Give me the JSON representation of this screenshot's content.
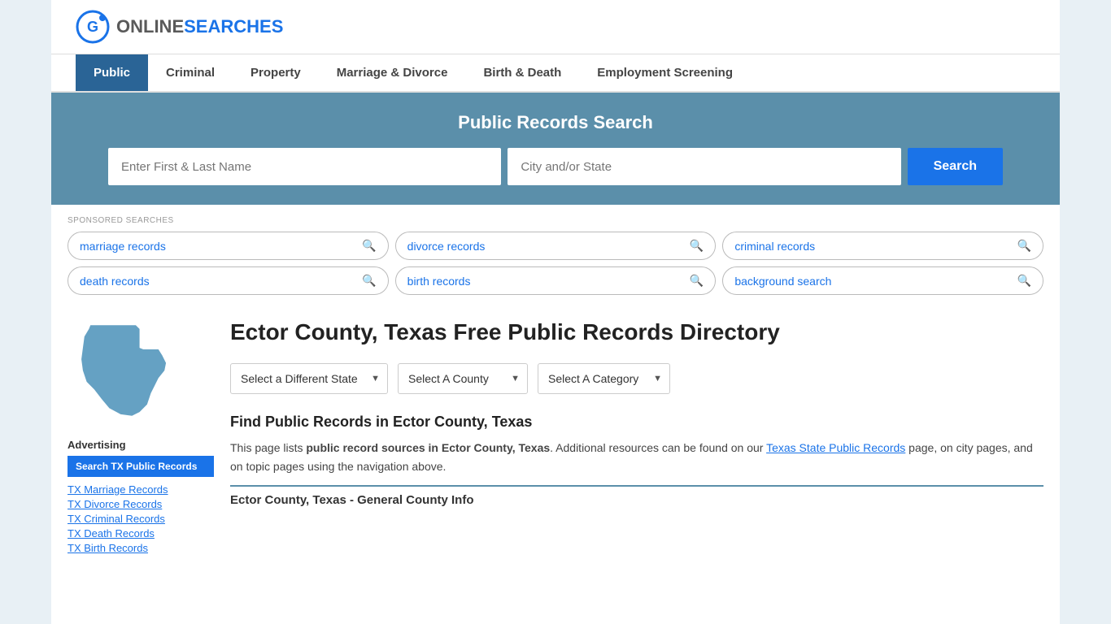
{
  "header": {
    "logo_online": "ONLINE",
    "logo_searches": "SEARCHES"
  },
  "nav": {
    "items": [
      {
        "label": "Public",
        "active": true
      },
      {
        "label": "Criminal",
        "active": false
      },
      {
        "label": "Property",
        "active": false
      },
      {
        "label": "Marriage & Divorce",
        "active": false
      },
      {
        "label": "Birth & Death",
        "active": false
      },
      {
        "label": "Employment Screening",
        "active": false
      }
    ]
  },
  "search_banner": {
    "title": "Public Records Search",
    "name_placeholder": "Enter First & Last Name",
    "location_placeholder": "City and/or State",
    "search_button": "Search"
  },
  "sponsored": {
    "label": "SPONSORED SEARCHES",
    "pills": [
      {
        "text": "marriage records"
      },
      {
        "text": "divorce records"
      },
      {
        "text": "criminal records"
      },
      {
        "text": "death records"
      },
      {
        "text": "birth records"
      },
      {
        "text": "background search"
      }
    ]
  },
  "sidebar": {
    "advertising_label": "Advertising",
    "ad_button": "Search TX Public Records",
    "links": [
      {
        "text": "TX Marriage Records"
      },
      {
        "text": "TX Divorce Records"
      },
      {
        "text": "TX Criminal Records"
      },
      {
        "text": "TX Death Records"
      },
      {
        "text": "TX Birth Records"
      }
    ]
  },
  "main_content": {
    "page_title": "Ector County, Texas Free Public Records Directory",
    "dropdowns": {
      "state": "Select a Different State",
      "county": "Select A County",
      "category": "Select A Category"
    },
    "find_title": "Find Public Records in Ector County, Texas",
    "find_text_1": "This page lists ",
    "find_bold": "public record sources in Ector County, Texas",
    "find_text_2": ". Additional resources can be found on our ",
    "find_link": "Texas State Public Records",
    "find_text_3": " page, on city pages, and on topic pages using the navigation above.",
    "general_info_label": "Ector County, Texas - General County Info"
  }
}
